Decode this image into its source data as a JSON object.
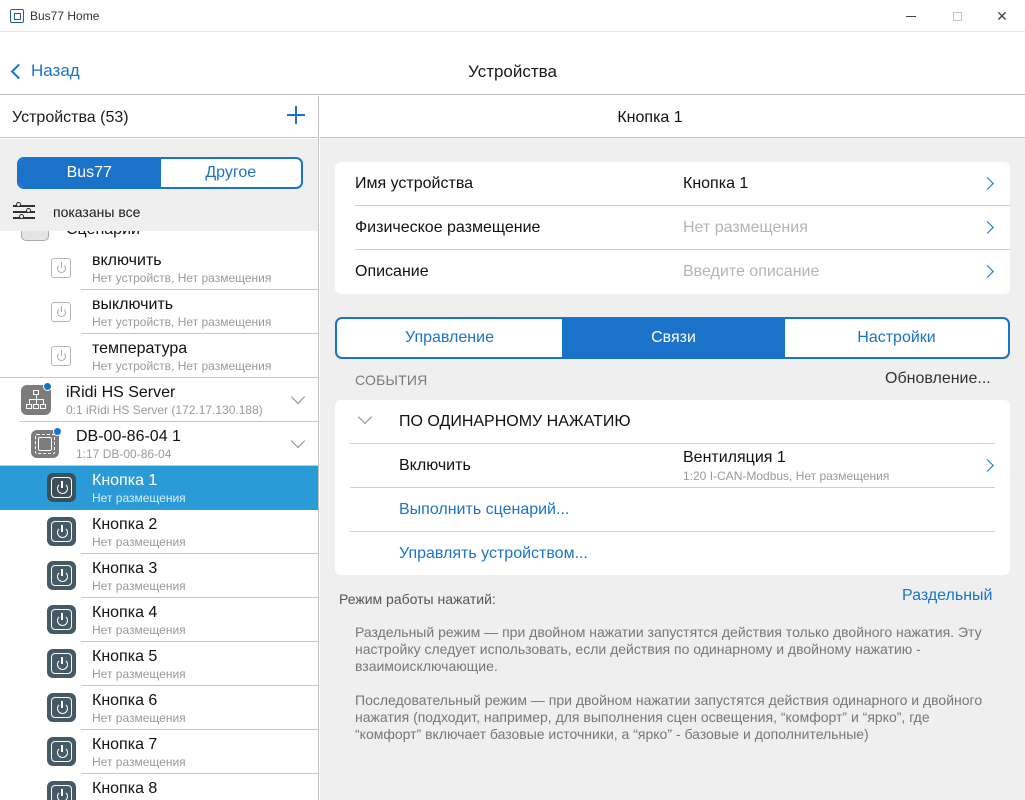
{
  "window": {
    "title": "Bus77 Home"
  },
  "nav": {
    "back_label": "Назад",
    "title": "Устройства"
  },
  "left": {
    "header": "Устройства (53)",
    "segments": [
      "Bus77",
      "Другое"
    ],
    "filter_text": "показаны все",
    "partial_row": "Сценарии",
    "scenario_rows": [
      {
        "title": "включить",
        "subtitle": "Нет устройств, Нет размещения"
      },
      {
        "title": "выключить",
        "subtitle": "Нет устройств, Нет размещения"
      },
      {
        "title": "температура",
        "subtitle": "Нет устройств, Нет размещения"
      }
    ],
    "server": {
      "title": "iRidi HS Server",
      "subtitle": "0:1 iRidi HS Server (172.17.130.188)"
    },
    "module": {
      "title": "DB-00-86-04 1",
      "subtitle": "1:17 DB-00-86-04"
    },
    "buttons": [
      {
        "title": "Кнопка 1",
        "subtitle": "Нет размещения",
        "selected": true
      },
      {
        "title": "Кнопка 2",
        "subtitle": "Нет размещения"
      },
      {
        "title": "Кнопка 3",
        "subtitle": "Нет размещения"
      },
      {
        "title": "Кнопка 4",
        "subtitle": "Нет размещения"
      },
      {
        "title": "Кнопка 5",
        "subtitle": "Нет размещения"
      },
      {
        "title": "Кнопка 6",
        "subtitle": "Нет размещения"
      },
      {
        "title": "Кнопка 7",
        "subtitle": "Нет размещения"
      },
      {
        "title": "Кнопка 8",
        "subtitle": ""
      }
    ]
  },
  "right": {
    "header": "Кнопка 1",
    "properties": [
      {
        "key": "Имя устройства",
        "value": "Кнопка 1",
        "placeholder": false
      },
      {
        "key": "Физическое размещение",
        "value": "Нет размещения",
        "placeholder": true
      },
      {
        "key": "Описание",
        "value": "Введите описание",
        "placeholder": true
      }
    ],
    "tabs": [
      "Управление",
      "Связи",
      "Настройки"
    ],
    "active_tab": 1,
    "events_title": "СОБЫТИЯ",
    "events_status": "Обновление...",
    "group_title": "ПО ОДИНАРНОМУ НАЖАТИЮ",
    "action": {
      "label": "Включить",
      "target": "Вентиляция 1",
      "target_sub": "1:20 I-CAN-Modbus, Нет размещения"
    },
    "link_scenario": "Выполнить сценарий...",
    "link_device": "Управлять устройством...",
    "mode_label": "Режим работы нажатий:",
    "mode_value": "Раздельный",
    "desc1": "Раздельный режим — при двойном нажатии запустятся действия только двойного нажатия. Эту настройку следует использовать, если действия по одинарному и двойному нажатию - взаимоисключающие.",
    "desc2": "Последовательный режим — при двойном нажатии запустятся действия одинарного и двойного нажатия (подходит, например, для выполнения сцен освещения, “комфорт” и “ярко”, где “комфорт” включает базовые источники, а “ярко” - базовые и дополнительные)"
  },
  "colors": {
    "accent": "#1a73c8",
    "selection": "#2a9bd6",
    "panel_bg": "#efefef"
  }
}
